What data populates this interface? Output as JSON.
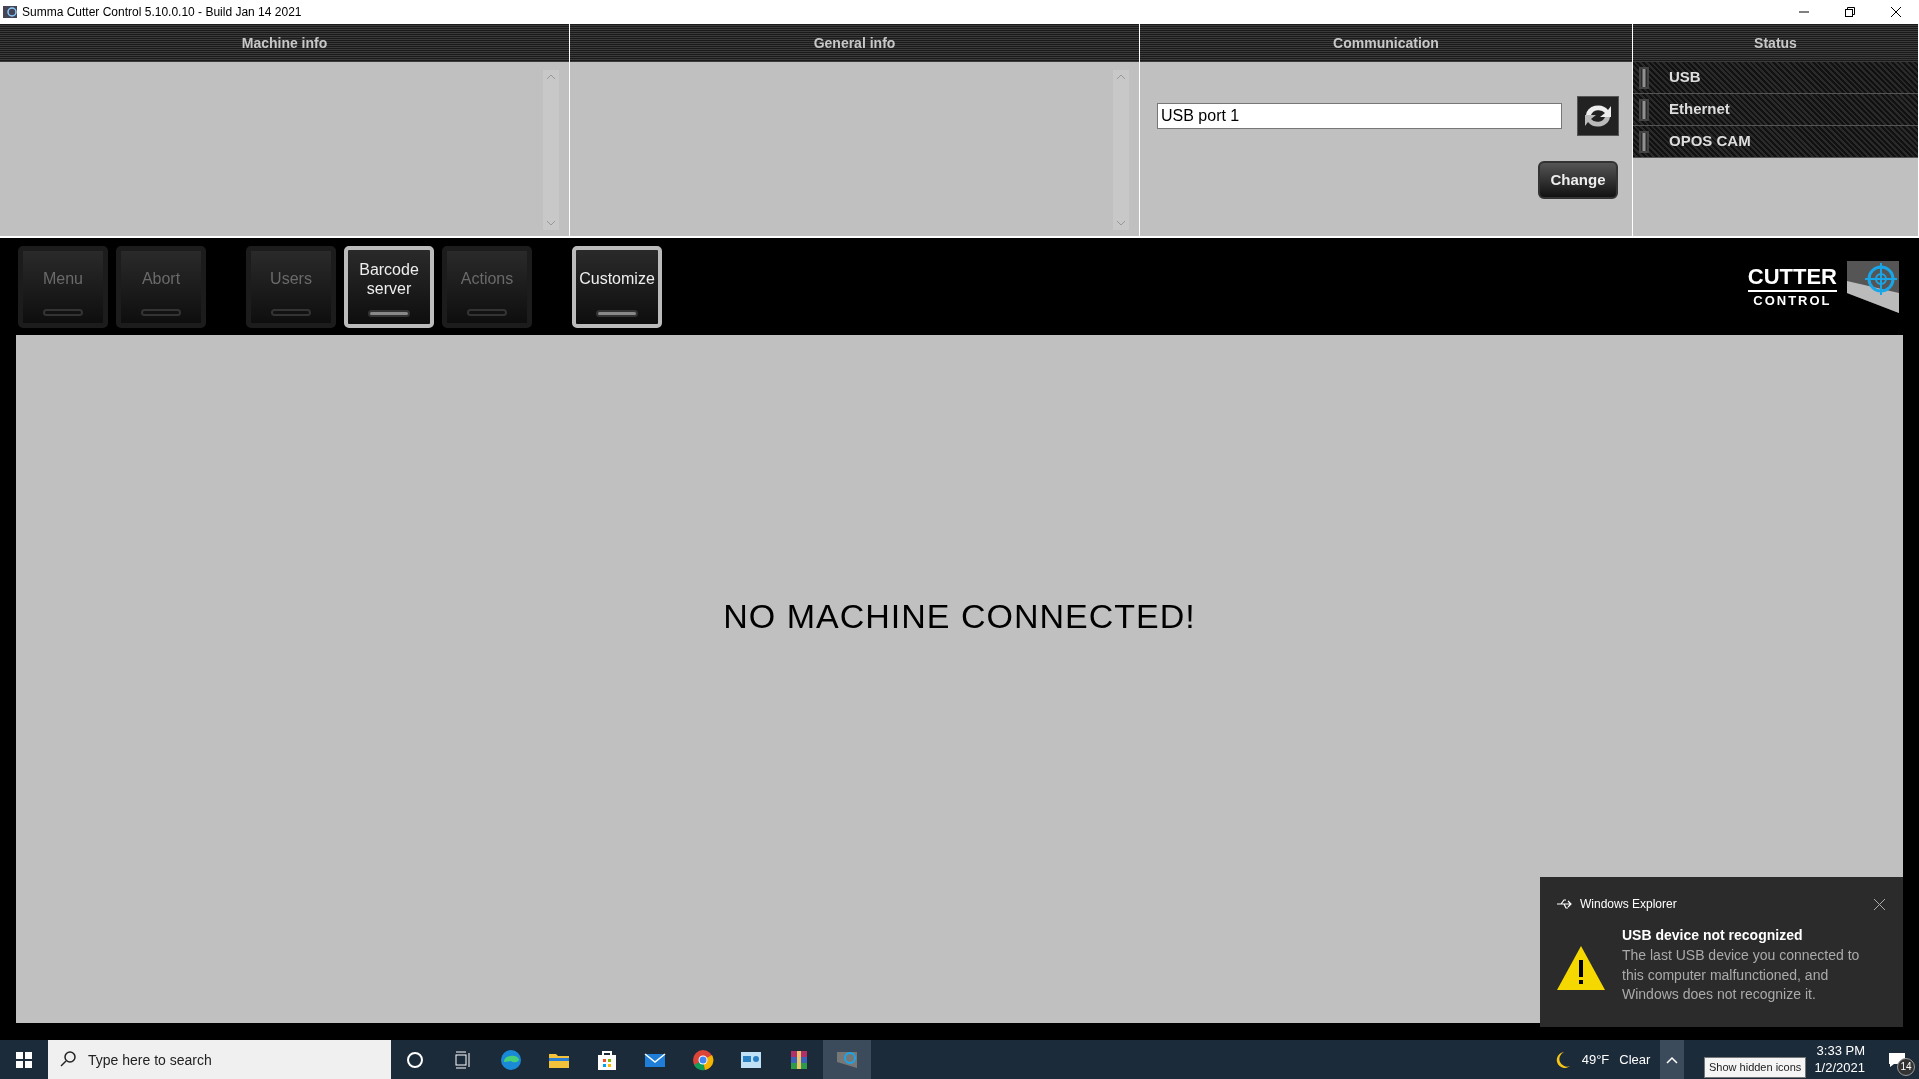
{
  "window": {
    "title": "Summa Cutter Control 5.10.0.10 - Build Jan 14 2021"
  },
  "panels": [
    {
      "heading": "Machine info"
    },
    {
      "heading": "General info"
    },
    {
      "heading": "Communication"
    },
    {
      "heading": "Status"
    }
  ],
  "communication": {
    "port": "USB port 1",
    "change_button": "Change"
  },
  "status": [
    {
      "label": "USB",
      "on": false
    },
    {
      "label": "Ethernet",
      "on": false
    },
    {
      "label": "OPOS CAM",
      "on": false
    }
  ],
  "toolbar_groups": [
    [
      {
        "label": "Menu",
        "disabled": true
      },
      {
        "label": "Abort",
        "disabled": true
      }
    ],
    [
      {
        "label": "Users",
        "disabled": true
      },
      {
        "label": "Barcode server",
        "disabled": false
      },
      {
        "label": "Actions",
        "disabled": true
      }
    ],
    [
      {
        "label": "Customize",
        "disabled": false
      }
    ]
  ],
  "logo": {
    "line_1": "CUTTER",
    "line_2": "CONTROL"
  },
  "main_message": "NO MACHINE CONNECTED!",
  "notification": {
    "app": "Windows Explorer",
    "title": "USB device not recognized",
    "body": "The last USB device you connected to this computer malfunctioned, and Windows does not recognize it."
  },
  "taskbar": {
    "search": {
      "placeholder": "Type here to search"
    },
    "apps": [
      {
        "kind": "edge",
        "selected": false
      },
      {
        "kind": "folder",
        "selected": false
      },
      {
        "kind": "store",
        "selected": false
      },
      {
        "kind": "mail",
        "selected": false
      },
      {
        "kind": "chrome",
        "selected": false
      },
      {
        "kind": "panel",
        "selected": false
      },
      {
        "kind": "archive",
        "selected": false
      },
      {
        "kind": "cutter",
        "selected": true
      }
    ],
    "weather": {
      "temperature": "49°F",
      "condition": "Clear"
    },
    "time": "3:33 PM",
    "date": "1/2/2021",
    "notifications_count": "14",
    "tooltip": "Show hidden icons"
  }
}
